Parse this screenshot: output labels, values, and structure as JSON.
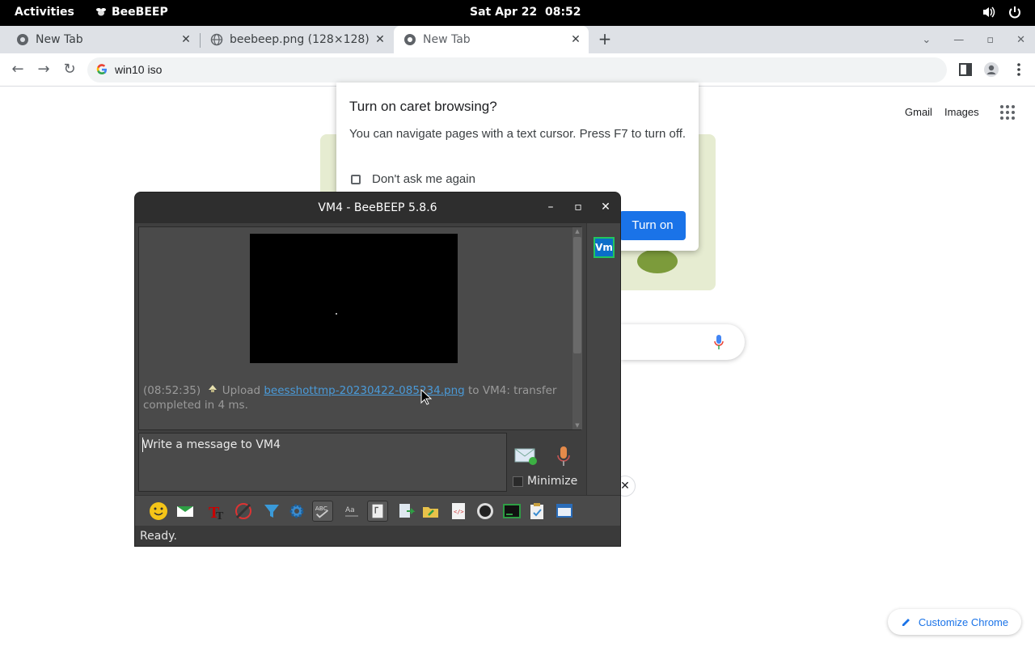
{
  "topbar": {
    "activities": "Activities",
    "app_name": "BeeBEEP",
    "clock": "Sat Apr 22  08:52"
  },
  "tabs": [
    {
      "title": "New Tab",
      "icon": "chrome-icon",
      "active": false
    },
    {
      "title": "beebeep.png (128×128)",
      "icon": "globe-icon",
      "active": false
    },
    {
      "title": "New Tab",
      "icon": "chrome-icon",
      "active": true
    }
  ],
  "omnibox": {
    "text": "win10 iso"
  },
  "google": {
    "gmail": "Gmail",
    "images": "Images",
    "customize_chrome": "Customize Chrome",
    "accent": "#1a73e8"
  },
  "caret_dialog": {
    "title": "Turn on caret browsing?",
    "body": "You can navigate pages with a text cursor. Press F7 to turn off.",
    "checkbox_label": "Don't ask me again",
    "button": "Turn on"
  },
  "beebeep": {
    "window_title": "VM4 - BeeBEEP 5.8.6",
    "message": {
      "time": "(08:52:35)",
      "prefix": " Upload ",
      "filename": "beesshottmp-20230422-085234.png",
      "suffix": " to VM4: transfer completed in 4 ms."
    },
    "user_badge": "Vm",
    "input_placeholder": "Write a message to VM4",
    "minimize_label": "Minimize",
    "status": "Ready.",
    "toolbar_icons": [
      "smiley-icon",
      "envelope-icon",
      "font-icon",
      "color-icon",
      "filter-icon",
      "settings-icon",
      "spellcheck-icon",
      "dictionary-icon",
      "note-icon",
      "file-send-icon",
      "folder-send-icon",
      "html-icon",
      "screenshot-icon",
      "terminal-icon",
      "clipboard-icon",
      "window-icon"
    ]
  }
}
